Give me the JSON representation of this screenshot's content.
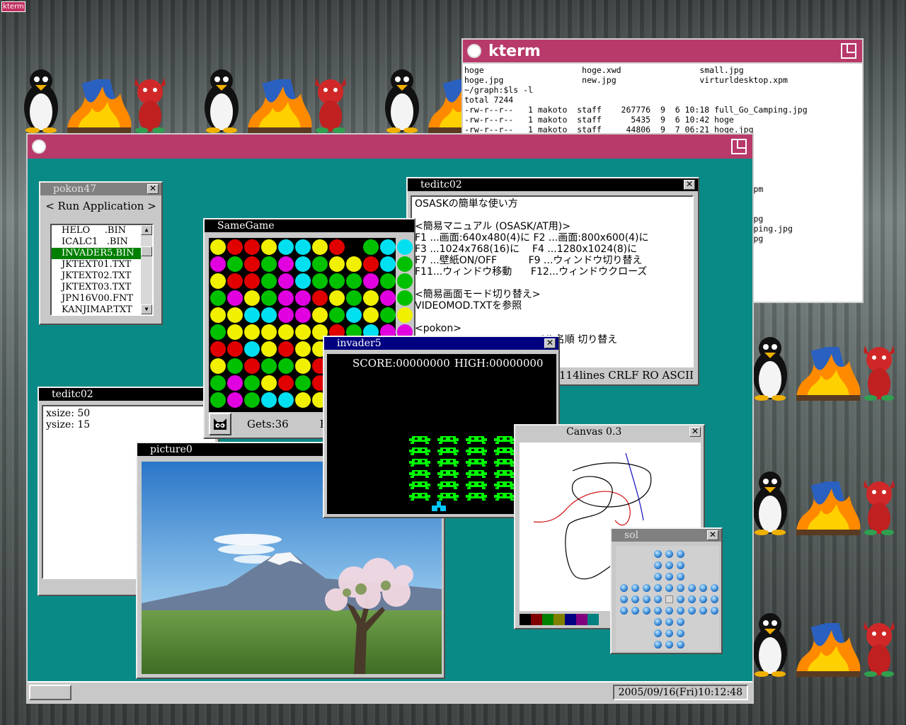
{
  "desktop": {
    "tag_label": "kterm"
  },
  "kterm": {
    "title": "kterm",
    "lines": [
      "hoge                    hoge.xwd                small.jpg",
      "hoge.jpg                new.jpg                 virturldesktop.xpm",
      "~/graph:$ls -l",
      "total 7244",
      "-rw-r--r--   1 makoto  staff    267776  9  6 10:18 full_Go_Camping.jpg",
      "-rw-r--r--   1 makoto  staff      5435  9  6 10:42 hoge",
      "-rw-r--r--   1 makoto  staff     44806  9  7 06:21 hoge.jpg",
      "",
      "",
      "",
      "                                                    w.jpg",
      "",
      "                                                    sktop.xpm",
      "",
      "",
      "                                                    mping.jpg",
      "                                                    _Go_Camping.jpg",
      "                                                    mping.jpg"
    ]
  },
  "taskbar": {
    "clock": "2005/09/16(Fri)10:12:48"
  },
  "pokon": {
    "title": "pokon47",
    "run_label": "< Run Application >",
    "files": [
      "HELO     .BIN",
      "ICALC1   .BIN",
      "INVADER5.BIN",
      "JKTEXT01.TXT",
      "JKTEXT02.TXT",
      "JKTEXT03.TXT",
      "JPN16V00.FNT",
      "KANJIMAP.TXT"
    ],
    "selected_index": 2
  },
  "tedit_top": {
    "title": "teditc02",
    "text": "OSASKの簡単な使い方\n\n<簡易マニュアル (OSASK/AT用)>\nF1 ...画面:640x480(4)に F2 ...画面:800x600(4)に\nF3 ...1024x768(16)に    F4 ...1280x1024(8)に\nF7 ...壁紙ON/OFF          F9 ...ウィンドウ切り替え\nF11...ウィンドウ移動      F12...ウィンドウクローズ\n\n<簡易画面モード切り替え>\nVIDEOMOD.TXTを参照\n\n<pokon>\n                                   ァイル名順 切り替え",
    "status": "114lines CRLF RO    ASCII"
  },
  "tedit_bottom": {
    "title": "teditc02",
    "text": "xsize: 50\nysize: 15"
  },
  "samegame": {
    "title": "SameGame",
    "gets_label": "Gets:36",
    "extra_label": "Re",
    "colors": {
      "red": "#e00000",
      "green": "#00c000",
      "yellow": "#f0f000",
      "cyan": "#00e0f0",
      "magenta": "#e000e0"
    },
    "grid": [
      "yrryccyr.gcc",
      "mgrgmcgyyrcg",
      "yrrgmcgggmgg",
      "gmygmmrygymg",
      "yyccmmygcygy",
      "gyyyyyyrgcmm",
      "rrcyryyrccgr",
      "ygrggyrgccgy",
      "gmgyrgrgcmyg",
      "gmgccyyrgmyc"
    ]
  },
  "picture": {
    "title": "picture0"
  },
  "invader": {
    "title": "invader5",
    "score": "SCORE:00000000",
    "high": "HIGH:00000000",
    "invader_color": "#00ff00",
    "player_color": "#00c8ff"
  },
  "canvas": {
    "title": "Canvas 0.3",
    "palette": [
      "#000000",
      "#800000",
      "#008000",
      "#808000",
      "#000080",
      "#800080",
      "#008080"
    ]
  },
  "sol": {
    "title": "sol"
  }
}
